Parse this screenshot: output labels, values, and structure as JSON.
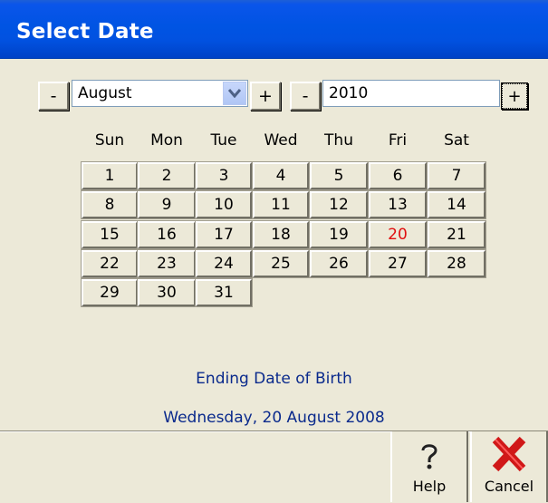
{
  "window": {
    "title": "Select Date"
  },
  "month_picker": {
    "decrement_label": "-",
    "value": "August",
    "increment_label": "+"
  },
  "year_picker": {
    "decrement_label": "-",
    "value": "2010",
    "increment_label": "+"
  },
  "weekdays": [
    "Sun",
    "Mon",
    "Tue",
    "Wed",
    "Thu",
    "Fri",
    "Sat"
  ],
  "days": [
    "1",
    "2",
    "3",
    "4",
    "5",
    "6",
    "7",
    "8",
    "9",
    "10",
    "11",
    "12",
    "13",
    "14",
    "15",
    "16",
    "17",
    "18",
    "19",
    "20",
    "21",
    "22",
    "23",
    "24",
    "25",
    "26",
    "27",
    "28",
    "29",
    "30",
    "31"
  ],
  "highlighted_day": "20",
  "colors": {
    "highlight_day": "#e01010",
    "caption": "#0a2a8c",
    "titlebar": "#0054e3"
  },
  "caption": {
    "label": "Ending Date of Birth",
    "date": "Wednesday, 20 August 2008"
  },
  "toolbar": {
    "help_label": "Help",
    "help_icon": "help-question-icon",
    "cancel_label": "Cancel",
    "cancel_icon": "red-x-icon"
  }
}
